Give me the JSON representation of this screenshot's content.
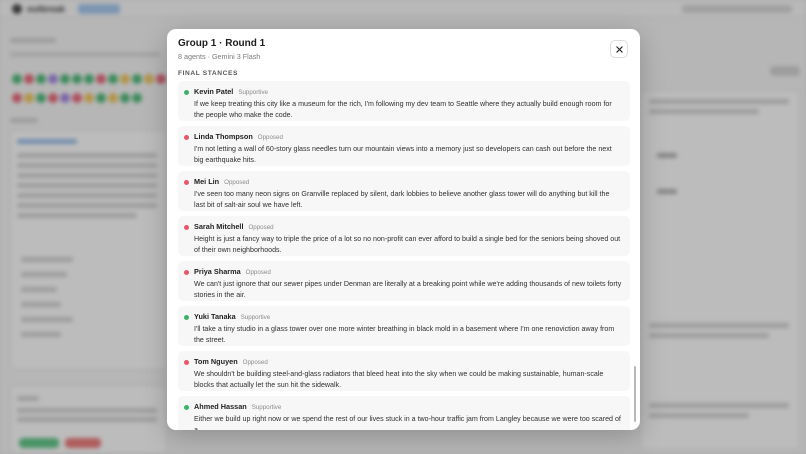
{
  "background": {
    "app_name": "outbreak",
    "dot_colors": [
      "#3bb36a",
      "#e8566a",
      "#3bb36a",
      "#9b7be0",
      "#3bb36a",
      "#3bb36a",
      "#3bb36a",
      "#e8566a",
      "#3bb36a",
      "#f2c14e",
      "#3bb36a",
      "#f2c14e",
      "#e8566a",
      "#e8566a",
      "#f2c14e",
      "#3bb36a",
      "#e8566a",
      "#9b7be0",
      "#e8566a",
      "#f2c14e",
      "#3bb36a",
      "#f2c14e",
      "#3bb36a",
      "#3bb36a"
    ]
  },
  "modal": {
    "title": "Group 1 · Round 1",
    "subtitle": "8 agents · Gemini 3 Flash",
    "section_label": "FINAL STANCES",
    "close_icon": "close-icon",
    "colors": {
      "supportive": "#3bb36a",
      "opposed": "#e8566a"
    },
    "stances": [
      {
        "name": "Kevin Patel",
        "status": "Supportive",
        "text": "If we keep treating this city like a museum for the rich, I'm following my dev team to Seattle where they actually build enough room for the people who make the code."
      },
      {
        "name": "Linda Thompson",
        "status": "Opposed",
        "text": "I'm not letting a wall of 60-story glass needles turn our mountain views into a memory just so developers can cash out before the next big earthquake hits."
      },
      {
        "name": "Mei Lin",
        "status": "Opposed",
        "text": "I've seen too many neon signs on Granville replaced by silent, dark lobbies to believe another glass tower will do anything but kill the last bit of salt-air soul we have left."
      },
      {
        "name": "Sarah Mitchell",
        "status": "Opposed",
        "text": "Height is just a fancy way to triple the price of a lot so no non-profit can ever afford to build a single bed for the seniors being shoved out of their own neighborhoods."
      },
      {
        "name": "Priya Sharma",
        "status": "Opposed",
        "text": "We can't just ignore that our sewer pipes under Denman are literally at a breaking point while we're adding thousands of new toilets forty stories in the air."
      },
      {
        "name": "Yuki Tanaka",
        "status": "Supportive",
        "text": "I'll take a tiny studio in a glass tower over one more winter breathing in black mold in a basement where I'm one renoviction away from the street."
      },
      {
        "name": "Tom Nguyen",
        "status": "Opposed",
        "text": "We shouldn't be building steel-and-glass radiators that bleed heat into the sky when we could be making sustainable, human-scale blocks that actually let the sun hit the sidewalk."
      },
      {
        "name": "Ahmed Hassan",
        "status": "Supportive",
        "text": "Either we build up right now or we spend the rest of our lives stuck in a two-hour traffic jam from Langley because we were too scared of a"
      }
    ]
  }
}
